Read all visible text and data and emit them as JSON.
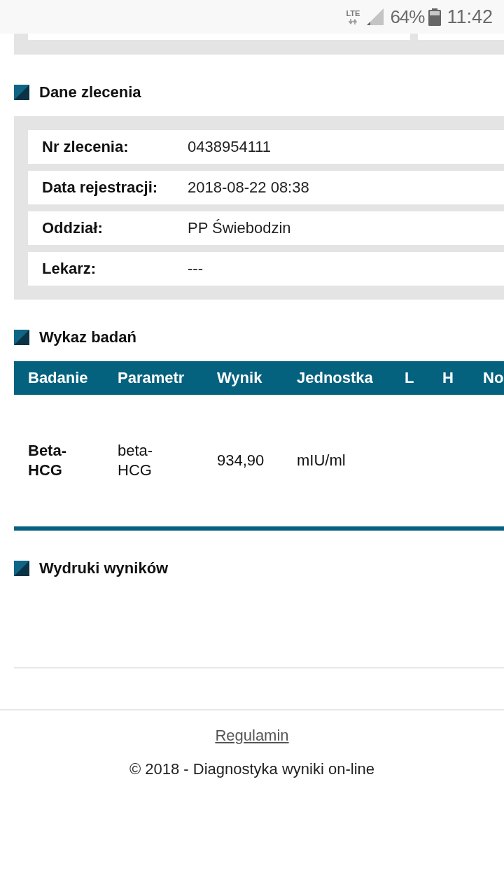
{
  "status_bar": {
    "network": "LTE",
    "battery": "64%",
    "time": "11:42"
  },
  "sections": [
    {
      "kind": "details",
      "title": "Dane zlecenia",
      "rows": [
        {
          "label": "Nr zlecenia:",
          "value": "0438954111"
        },
        {
          "label": "Data rejestracji:",
          "value": "2018-08-22 08:38"
        },
        {
          "label": "Oddział:",
          "value": "PP Świebodzin"
        },
        {
          "label": "Lekarz:",
          "value": "---"
        }
      ]
    },
    {
      "kind": "table",
      "title": "Wykaz badań",
      "columns": [
        "Badanie",
        "Parametr",
        "Wynik",
        "Jednostka",
        "L",
        "H",
        "No"
      ],
      "rows": [
        {
          "cells": [
            "Beta-HCG",
            "beta-HCG",
            "934,90",
            "mIU/ml"
          ]
        }
      ]
    },
    {
      "kind": "prints",
      "title": "Wydruki wyników"
    }
  ],
  "footer": {
    "link": "Regulamin",
    "copyright": "© 2018 - Diagnostyka wyniki on-line"
  }
}
